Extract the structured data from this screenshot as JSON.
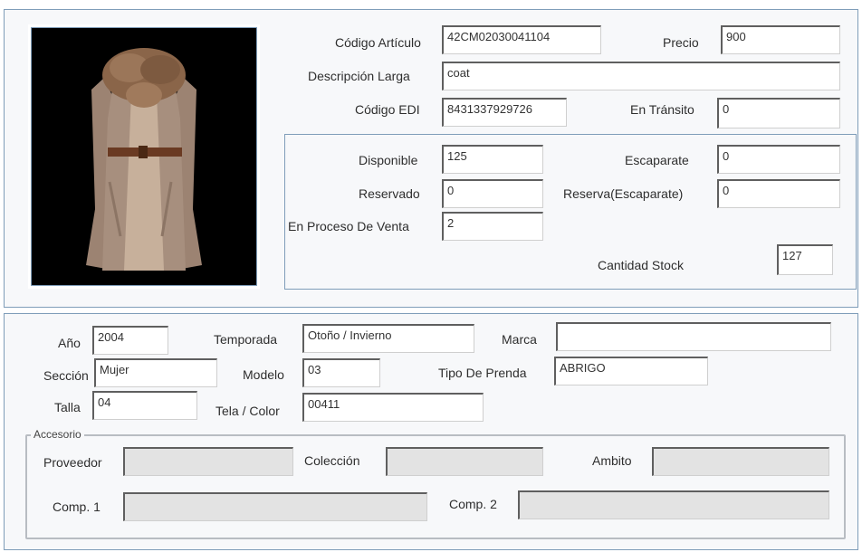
{
  "top": {
    "codigo_articulo_label": "Código Artículo",
    "codigo_articulo_value": "42CM02030041104",
    "precio_label": "Precio",
    "precio_value": "900",
    "descripcion_larga_label": "Descripción Larga",
    "descripcion_larga_value": "coat",
    "codigo_edi_label": "Código EDI",
    "codigo_edi_value": "8431337929726",
    "en_transito_label": "En Tránsito",
    "en_transito_value": "0"
  },
  "stock": {
    "disponible_label": "Disponible",
    "disponible_value": "125",
    "escaparate_label": "Escaparate",
    "escaparate_value": "0",
    "reservado_label": "Reservado",
    "reservado_value": "0",
    "reserva_escaparate_label": "Reserva(Escaparate)",
    "reserva_escaparate_value": "0",
    "en_proceso_label": "En Proceso De Venta",
    "en_proceso_value": "2",
    "cantidad_stock_label": "Cantidad Stock",
    "cantidad_stock_value": "127"
  },
  "details": {
    "anio_label": "Año",
    "anio_value": "2004",
    "temporada_label": "Temporada",
    "temporada_value": "Otoño / Invierno",
    "marca_label": "Marca",
    "marca_value": "",
    "seccion_label": "Sección",
    "seccion_value": "Mujer",
    "modelo_label": "Modelo",
    "modelo_value": "03",
    "tipo_prenda_label": "Tipo De Prenda",
    "tipo_prenda_value": "ABRIGO",
    "talla_label": "Talla",
    "talla_value": "04",
    "tela_color_label": "Tela / Color",
    "tela_color_value": "00411"
  },
  "accesorio": {
    "title": "Accesorio",
    "proveedor_label": "Proveedor",
    "proveedor_value": "",
    "coleccion_label": "Colección",
    "coleccion_value": "",
    "ambito_label": "Ambito",
    "ambito_value": "",
    "comp1_label": "Comp. 1",
    "comp1_value": "",
    "comp2_label": "Comp. 2",
    "comp2_value": ""
  },
  "colors": {
    "panel_border": "#7f9db9",
    "panel_bg": "#f7f8fa",
    "disabled_field": "#e3e3e3"
  }
}
